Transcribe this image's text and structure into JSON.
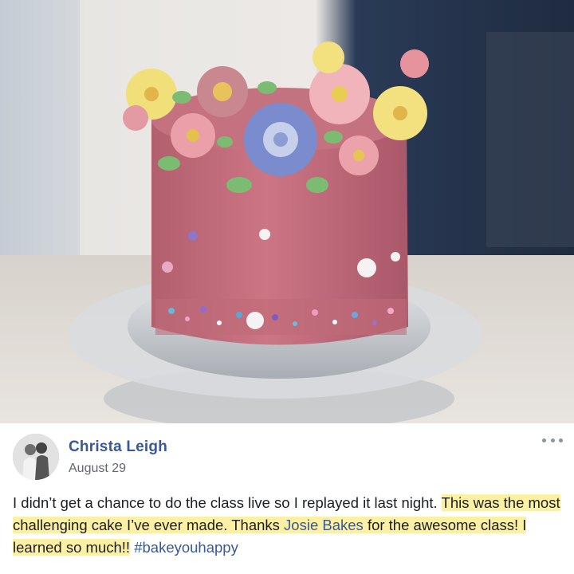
{
  "post": {
    "author": "Christa Leigh",
    "date": "August 29",
    "text_plain": "I didn’t get a chance to do the class live so I replayed it last night.",
    "text_highlight_1": "This was the most challenging cake I’ve ever made. Thanks",
    "mention": "Josie Bakes",
    "text_highlight_2": "for the awesome class! I learned so much!!",
    "hashtag": "#bakeyouhappy"
  },
  "icons": {
    "more": "more-horizontal-icon",
    "avatar": "profile-photo"
  },
  "colors": {
    "author_link": "#385898",
    "highlight": "#fbf0a4",
    "cake_pink": "#c8717e"
  }
}
